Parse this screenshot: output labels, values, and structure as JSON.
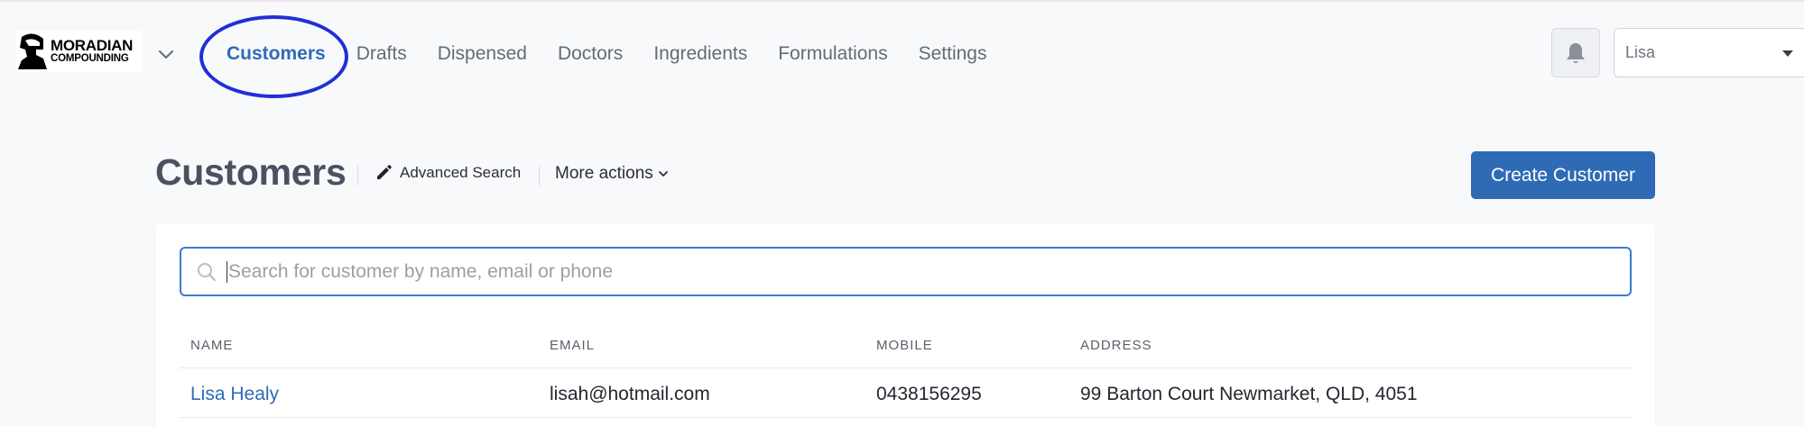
{
  "brand": {
    "line1": "MORADIAN",
    "line2": "COMPOUNDING",
    "icons": [
      "spartan-helmet-icon"
    ]
  },
  "nav": {
    "items": [
      {
        "label": "Customers",
        "active": true
      },
      {
        "label": "Drafts"
      },
      {
        "label": "Dispensed"
      },
      {
        "label": "Doctors"
      },
      {
        "label": "Ingredients"
      },
      {
        "label": "Formulations"
      },
      {
        "label": "Settings"
      }
    ],
    "icons": [
      "chevron-down-icon",
      "bell-icon"
    ]
  },
  "user": {
    "selected": "Lisa"
  },
  "page": {
    "title": "Customers",
    "advanced_search": "Advanced Search",
    "more_actions": "More actions",
    "create_button": "Create Customer"
  },
  "search": {
    "placeholder": "Search for customer by name, email or phone",
    "value": ""
  },
  "table": {
    "columns": [
      "NAME",
      "EMAIL",
      "MOBILE",
      "ADDRESS"
    ],
    "rows": [
      {
        "name": "Lisa Healy",
        "email": "lisah@hotmail.com",
        "mobile": "0438156295",
        "address": "99 Barton Court Newmarket, QLD, 4051"
      }
    ]
  },
  "colors": {
    "accent": "#2f6bb5",
    "annotation_ring": "#1f2fd8",
    "background": "#f8f9fb"
  }
}
